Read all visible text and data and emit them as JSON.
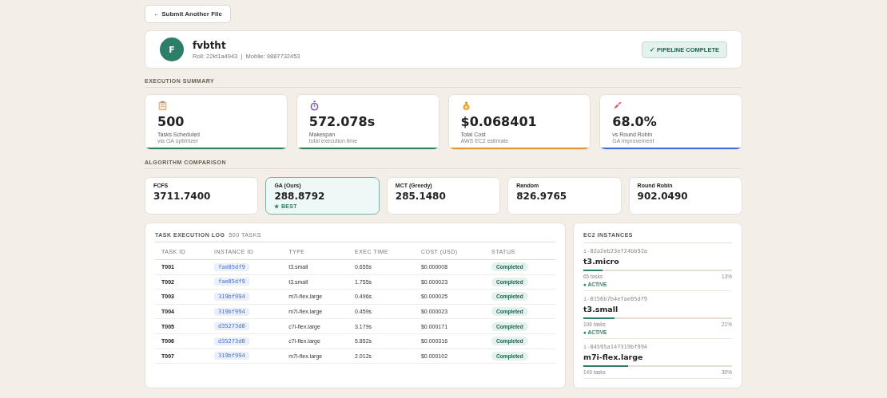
{
  "back_button": "← Submit Another File",
  "profile": {
    "initial": "F",
    "name": "fvbtht",
    "details": "Roll: 22kt1a4943  |  Mobile: 9887732453",
    "badge": "✓ PIPELINE COMPLETE"
  },
  "summary": {
    "title": "EXECUTION SUMMARY",
    "stats": [
      {
        "kind": "clipboard",
        "value": "500",
        "label": "Tasks Scheduled",
        "sub": "via GA optimizer",
        "color": "#2e7d68"
      },
      {
        "kind": "stopwatch",
        "value": "572.078s",
        "label": "Makespan",
        "sub": "total execution time",
        "color": "#2e7d68"
      },
      {
        "kind": "moneybag",
        "value": "$0.068401",
        "label": "Total Cost",
        "sub": "AWS EC2 estimate",
        "color": "#e0962a"
      },
      {
        "kind": "rocket",
        "value": "68.0%",
        "label": "vs Round Robin",
        "sub": "GA improvement",
        "color": "#3b6fd6"
      }
    ]
  },
  "comparison": {
    "title": "ALGORITHM COMPARISON",
    "algorithms": [
      {
        "name": "FCFS",
        "value": "3711.7400",
        "selected": false
      },
      {
        "name": "GA (Ours)",
        "value": "288.8792",
        "selected": true,
        "badge": "★ BEST"
      },
      {
        "name": "MCT (Greedy)",
        "value": "285.1480",
        "selected": false
      },
      {
        "name": "Random",
        "value": "826.9765",
        "selected": false
      },
      {
        "name": "Round Robin",
        "value": "902.0490",
        "selected": false
      }
    ]
  },
  "task_log": {
    "title": "TASK EXECUTION LOG",
    "count": "500 TASKS",
    "columns": [
      "TASK ID",
      "INSTANCE ID",
      "TYPE",
      "EXEC TIME",
      "COST (USD)",
      "STATUS"
    ],
    "rows": [
      {
        "task_id": "T001",
        "instance_id": "fae85df9",
        "type": "t3.small",
        "exec_time": "0.655s",
        "cost": "$0.000008",
        "status": "Completed"
      },
      {
        "task_id": "T002",
        "instance_id": "fae85df9",
        "type": "t3.small",
        "exec_time": "1.755s",
        "cost": "$0.000023",
        "status": "Completed"
      },
      {
        "task_id": "T003",
        "instance_id": "319bf994",
        "type": "m7i-flex.large",
        "exec_time": "0.496s",
        "cost": "$0.000025",
        "status": "Completed"
      },
      {
        "task_id": "T004",
        "instance_id": "319bf994",
        "type": "m7i-flex.large",
        "exec_time": "0.459s",
        "cost": "$0.000023",
        "status": "Completed"
      },
      {
        "task_id": "T005",
        "instance_id": "d35273d0",
        "type": "c7i-flex.large",
        "exec_time": "3.179s",
        "cost": "$0.000171",
        "status": "Completed"
      },
      {
        "task_id": "T006",
        "instance_id": "d35273d0",
        "type": "c7i-flex.large",
        "exec_time": "5.852s",
        "cost": "$0.000316",
        "status": "Completed"
      },
      {
        "task_id": "T007",
        "instance_id": "319bf994",
        "type": "m7i-flex.large",
        "exec_time": "2.012s",
        "cost": "$0.000102",
        "status": "Completed"
      }
    ]
  },
  "instances": {
    "title": "EC2 INSTANCES",
    "items": [
      {
        "id": "i-02a2eb23ef24bb92a",
        "type": "t3.micro",
        "level": 0.13,
        "tasks": "65 tasks",
        "percent": "13%",
        "status": "● ACTIVE"
      },
      {
        "id": "i-0156b7b4efae85df9",
        "type": "t3.small",
        "level": 0.21,
        "tasks": "106 tasks",
        "percent": "21%",
        "status": "● ACTIVE"
      },
      {
        "id": "i-04595a147319bf994",
        "type": "m7i-flex.large",
        "level": 0.3,
        "tasks": "149 tasks",
        "percent": "30%"
      }
    ]
  }
}
